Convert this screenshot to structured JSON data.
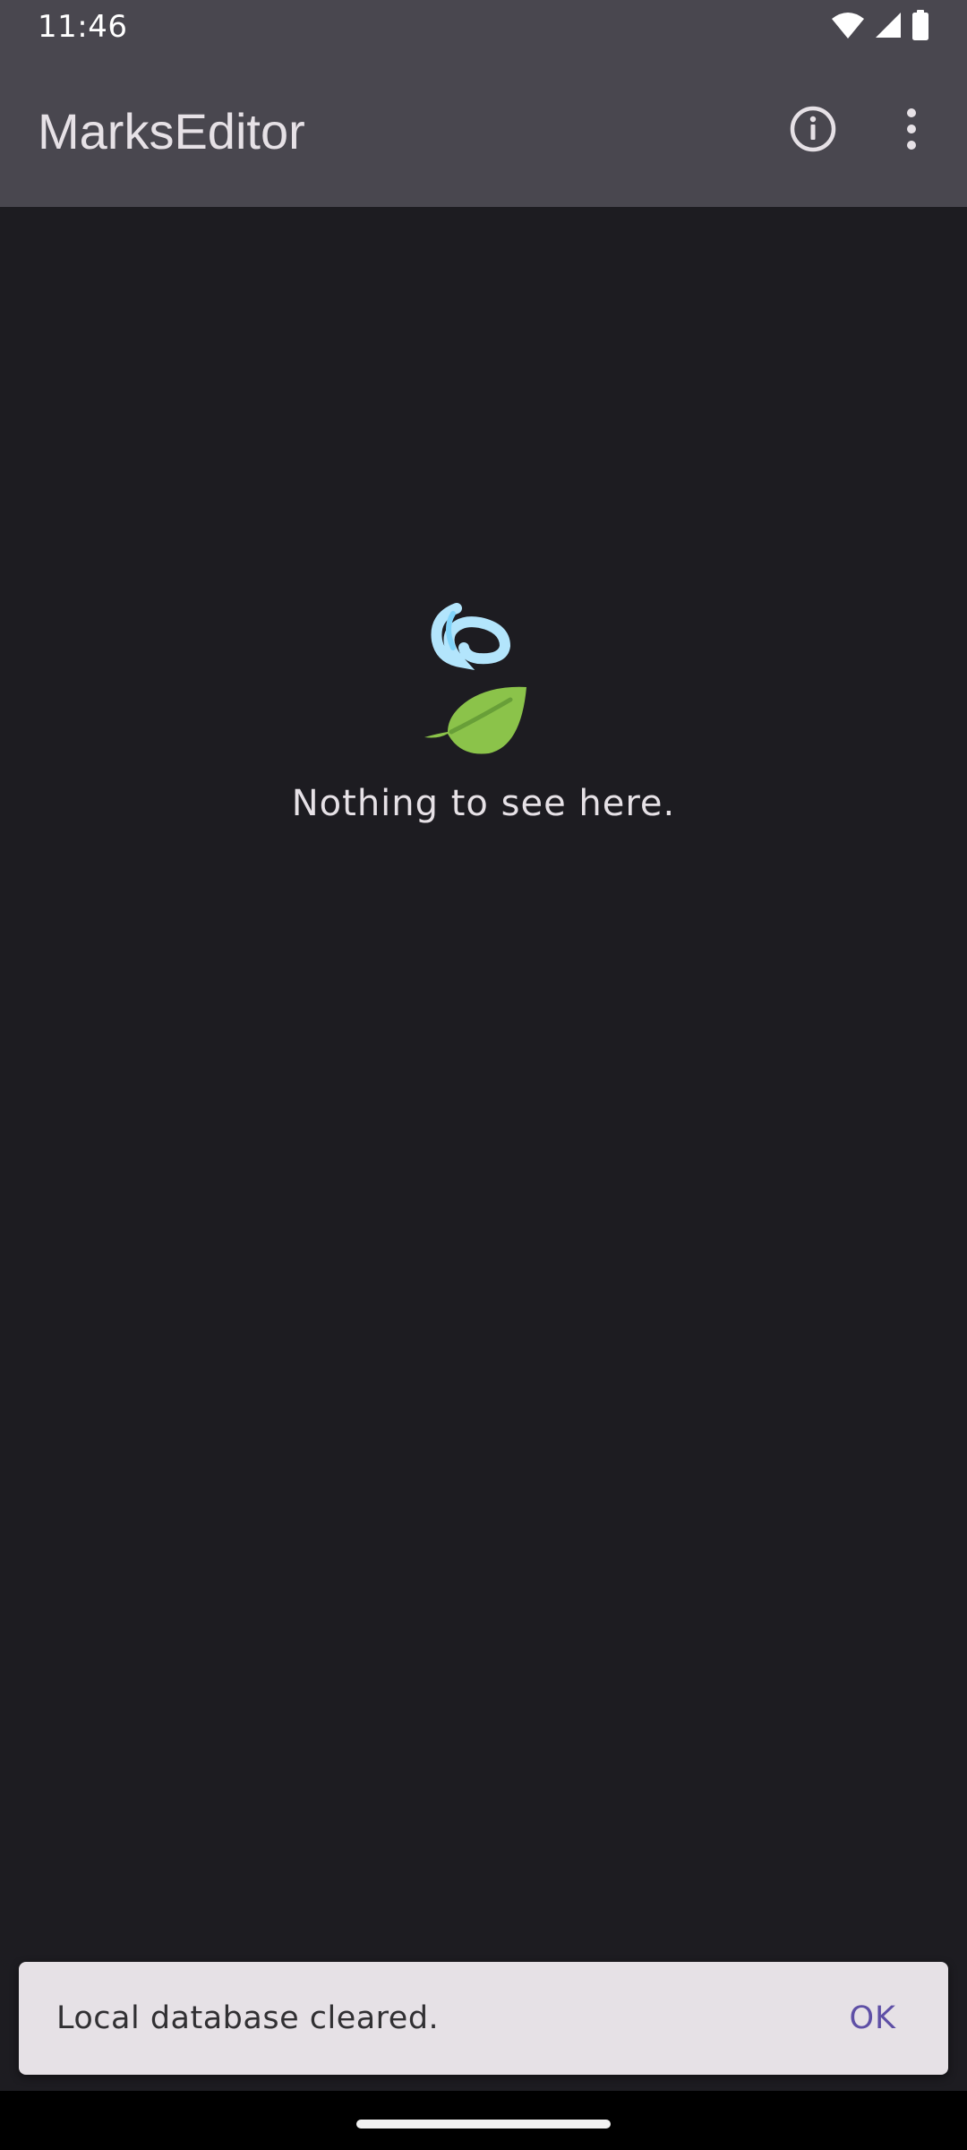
{
  "status_bar": {
    "time": "11:46",
    "icons": [
      "wifi-icon",
      "signal-icon",
      "battery-icon"
    ]
  },
  "app_bar": {
    "title": "MarksEditor",
    "actions": [
      "info-icon",
      "more-vert-icon"
    ]
  },
  "empty_state": {
    "icon": "wind-leaf-icon",
    "message": "Nothing to see here."
  },
  "snackbar": {
    "message": "Local database cleared.",
    "action_label": "OK"
  },
  "colors": {
    "app_bar": "#49474f",
    "background": "#1d1c21",
    "snackbar": "#e6e1e6",
    "snackbar_action": "#5e4fa6",
    "leaf": "#8bc34a",
    "swirl": "#b3e5fc"
  }
}
